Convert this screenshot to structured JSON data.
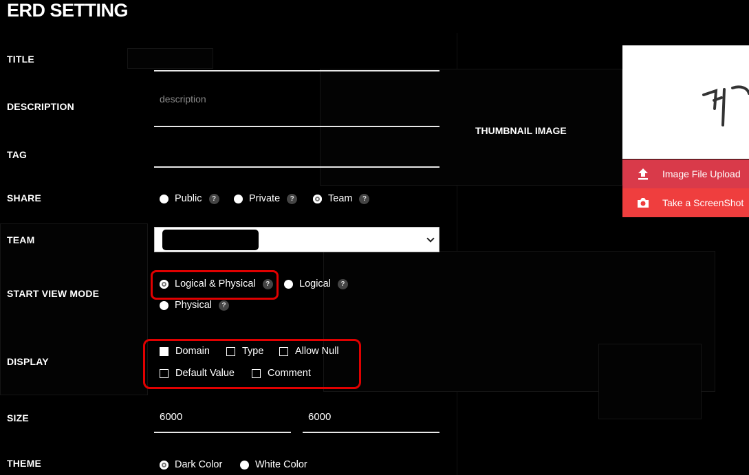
{
  "title": "ERD SETTING",
  "fields": {
    "title_label": "TITLE",
    "description_label": "DESCRIPTION",
    "description_placeholder": "description",
    "tag_label": "TAG",
    "share_label": "SHARE",
    "team_label": "TEAM",
    "start_view_mode_label": "START VIEW MODE",
    "display_label": "DISPLAY",
    "size_label": "SIZE",
    "theme_label": "THEME"
  },
  "share": {
    "options": [
      "Public",
      "Private",
      "Team"
    ],
    "selected": "Team"
  },
  "start_view_mode": {
    "options": [
      "Logical & Physical",
      "Logical",
      "Physical"
    ],
    "selected": "Logical & Physical"
  },
  "display": {
    "options": [
      "Domain",
      "Type",
      "Allow Null",
      "Default Value",
      "Comment"
    ],
    "checked": [
      "Domain"
    ]
  },
  "size": {
    "width": "6000",
    "height": "6000"
  },
  "theme": {
    "options": [
      "Dark Color",
      "White Color"
    ],
    "selected": "Dark Color"
  },
  "thumbnail": {
    "label": "THUMBNAIL IMAGE",
    "upload_label": "Image File Upload",
    "screenshot_label": "Take a ScreenShot"
  },
  "help_glyph": "?",
  "colors": {
    "upload_button": "#d93a4a",
    "screenshot_button": "#ef3e3e",
    "highlight_box": "#e00000"
  }
}
